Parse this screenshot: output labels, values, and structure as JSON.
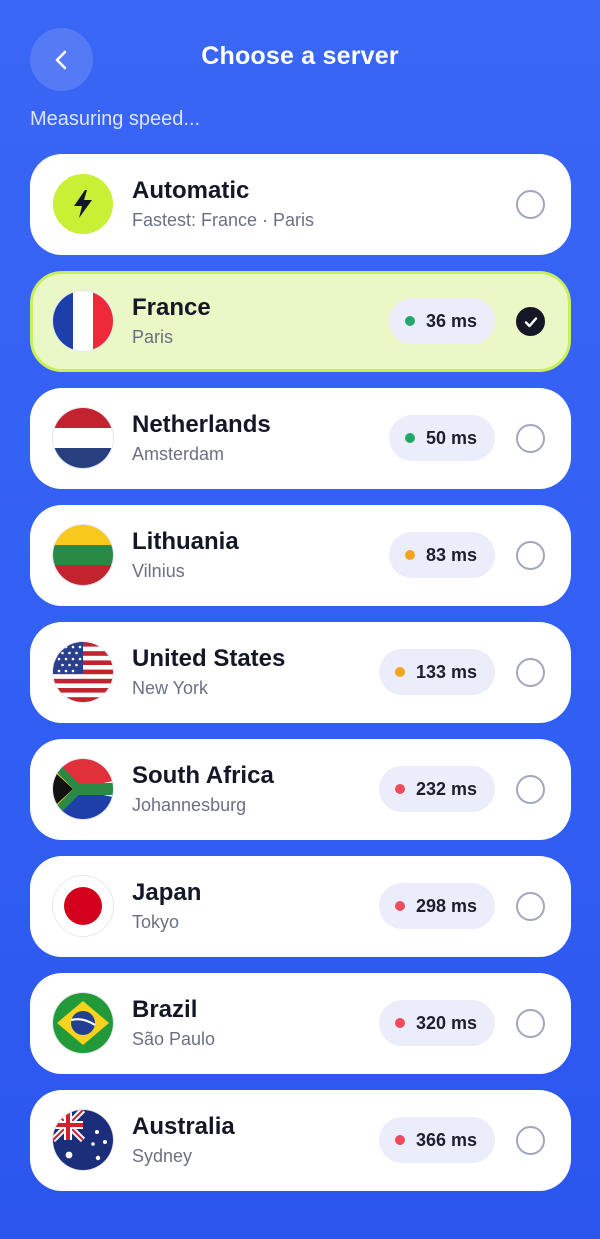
{
  "header": {
    "title": "Choose a server",
    "back_icon": "chevron-left-icon",
    "status": "Measuring speed..."
  },
  "colors": {
    "background": "#3260f4",
    "accent": "#c8f135",
    "selected_bg": "#eaf8c6",
    "ping_good": "#20a86a",
    "ping_medium": "#f3a41f",
    "ping_bad": "#ee4b5d"
  },
  "automatic": {
    "name": "Automatic",
    "sub": "Fastest: France · Paris",
    "icon": "lightning-bolt-icon",
    "selected": false
  },
  "servers": [
    {
      "name": "France",
      "city": "Paris",
      "ping": "36 ms",
      "quality": "good",
      "flag": "france-flag-icon",
      "selected": true
    },
    {
      "name": "Netherlands",
      "city": "Amsterdam",
      "ping": "50 ms",
      "quality": "good",
      "flag": "netherlands-flag-icon",
      "selected": false
    },
    {
      "name": "Lithuania",
      "city": "Vilnius",
      "ping": "83 ms",
      "quality": "medium",
      "flag": "lithuania-flag-icon",
      "selected": false
    },
    {
      "name": "United States",
      "city": "New York",
      "ping": "133 ms",
      "quality": "medium",
      "flag": "usa-flag-icon",
      "selected": false
    },
    {
      "name": "South Africa",
      "city": "Johannesburg",
      "ping": "232 ms",
      "quality": "bad",
      "flag": "south-africa-flag-icon",
      "selected": false
    },
    {
      "name": "Japan",
      "city": "Tokyo",
      "ping": "298 ms",
      "quality": "bad",
      "flag": "japan-flag-icon",
      "selected": false
    },
    {
      "name": "Brazil",
      "city": "São Paulo",
      "ping": "320 ms",
      "quality": "bad",
      "flag": "brazil-flag-icon",
      "selected": false
    },
    {
      "name": "Australia",
      "city": "Sydney",
      "ping": "366 ms",
      "quality": "bad",
      "flag": "australia-flag-icon",
      "selected": false
    }
  ]
}
